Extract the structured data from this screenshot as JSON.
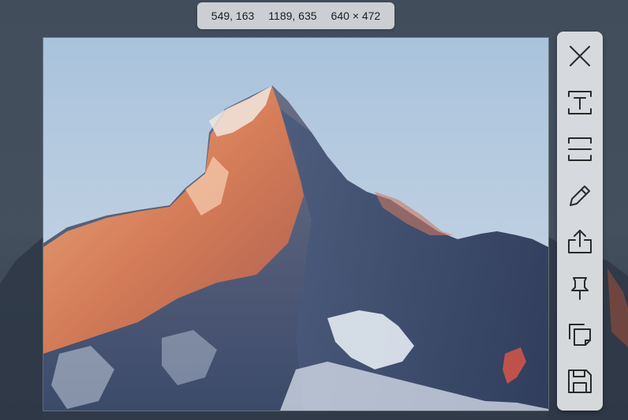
{
  "coords": {
    "start": "549, 163",
    "end": "1189, 635",
    "size": "640 × 472"
  },
  "toolbar": {
    "tools": [
      {
        "icon": "close-icon",
        "name": "close"
      },
      {
        "icon": "text-extract-icon",
        "name": "extract-text"
      },
      {
        "icon": "long-screenshot-icon",
        "name": "scroll-capture"
      },
      {
        "icon": "pencil-icon",
        "name": "annotate"
      },
      {
        "icon": "share-icon",
        "name": "share"
      },
      {
        "icon": "pin-icon",
        "name": "pin"
      },
      {
        "icon": "copy-icon",
        "name": "copy"
      },
      {
        "icon": "save-icon",
        "name": "save"
      }
    ]
  },
  "colors": {
    "toolbar_bg": "#dee1e5",
    "info_bg": "#d7dade",
    "sky_top": "#a9c3dc",
    "sky_bottom": "#cfd9e6",
    "alpenglow": "#e8895a"
  }
}
